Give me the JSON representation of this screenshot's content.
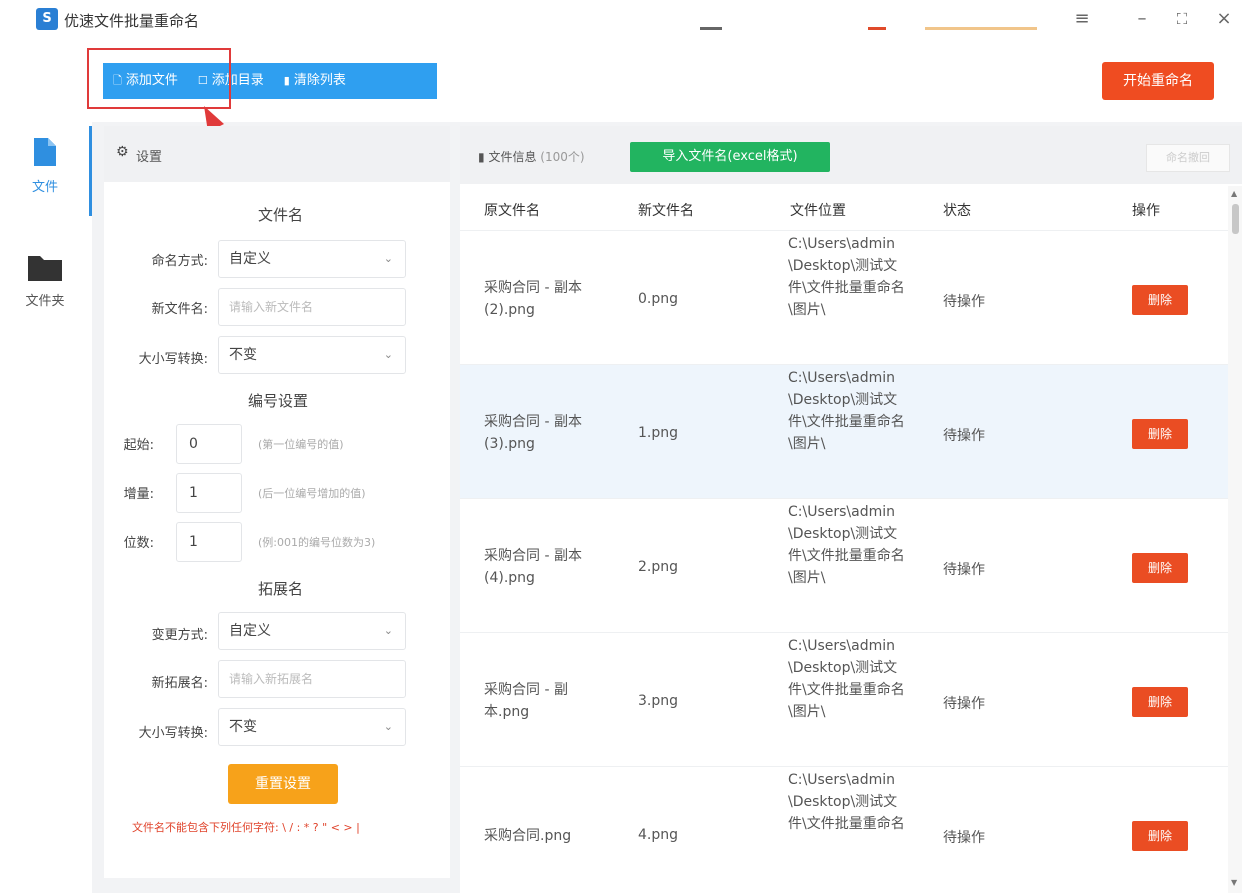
{
  "window": {
    "title": "优速文件批量重命名",
    "logo_text": "S",
    "controls": {
      "menu": "≡",
      "minimize": "–",
      "maximize": "⛶",
      "close": "×"
    }
  },
  "toolbar": {
    "add_file": "添加文件",
    "add_folder": "添加目录",
    "clear_list": "清除列表",
    "start_rename": "开始重命名"
  },
  "sidenav": {
    "items": [
      {
        "label": "文件",
        "icon": "file-icon",
        "active": true
      },
      {
        "label": "文件夹",
        "icon": "folder-icon",
        "active": false
      }
    ]
  },
  "settings": {
    "header": "设置",
    "filename_section": {
      "title": "文件名",
      "naming_method_label": "命名方式:",
      "naming_method_value": "自定义",
      "new_name_label": "新文件名:",
      "new_name_placeholder": "请输入新文件名",
      "case_label": "大小写转换:",
      "case_value": "不变"
    },
    "numbering_section": {
      "title": "编号设置",
      "start_label": "起始:",
      "start_value": "0",
      "start_hint": "(第一位编号的值)",
      "step_label": "增量:",
      "step_value": "1",
      "step_hint": "(后一位编号增加的值)",
      "digits_label": "位数:",
      "digits_value": "1",
      "digits_hint": "(例:001的编号位数为3)"
    },
    "extension_section": {
      "title": "拓展名",
      "change_method_label": "变更方式:",
      "change_method_value": "自定义",
      "new_ext_label": "新拓展名:",
      "new_ext_placeholder": "请输入新拓展名",
      "case_label": "大小写转换:",
      "case_value": "不变"
    },
    "reset_button": "重置设置",
    "warning": "文件名不能包含下列任何字符: \\ / : * ? \" < > |"
  },
  "file_panel": {
    "info_label": "文件信息",
    "count": "(100个)",
    "import_button": "导入文件名(excel格式)",
    "history_button": "命名撤回",
    "columns": [
      "原文件名",
      "新文件名",
      "文件位置",
      "状态",
      "操作"
    ],
    "rows": [
      {
        "original": "采购合同 - 副本 (2).png",
        "new": "0.png",
        "path": "C:\\Users\\admin\\Desktop\\测试文件\\文件批量重命名\\图片\\",
        "status": "待操作",
        "action": "删除"
      },
      {
        "original": "采购合同 - 副本 (3).png",
        "new": "1.png",
        "path": "C:\\Users\\admin\\Desktop\\测试文件\\文件批量重命名\\图片\\",
        "status": "待操作",
        "action": "删除"
      },
      {
        "original": "采购合同 - 副本 (4).png",
        "new": "2.png",
        "path": "C:\\Users\\admin\\Desktop\\测试文件\\文件批量重命名\\图片\\",
        "status": "待操作",
        "action": "删除"
      },
      {
        "original": "采购合同 - 副本.png",
        "new": "3.png",
        "path": "C:\\Users\\admin\\Desktop\\测试文件\\文件批量重命名\\图片\\",
        "status": "待操作",
        "action": "删除"
      },
      {
        "original": "采购合同.png",
        "new": "4.png",
        "path": "C:\\Users\\admin\\Desktop\\测试文件\\文件批量重命名",
        "status": "待操作",
        "action": "删除"
      }
    ]
  },
  "colors": {
    "toolbar_blue": "#2f9ff0",
    "start_orange": "#ef4c21",
    "import_green": "#22b460",
    "delete_red": "#ea4d23",
    "reset_orange": "#f7a21a",
    "highlight_red": "#e03a3a"
  }
}
